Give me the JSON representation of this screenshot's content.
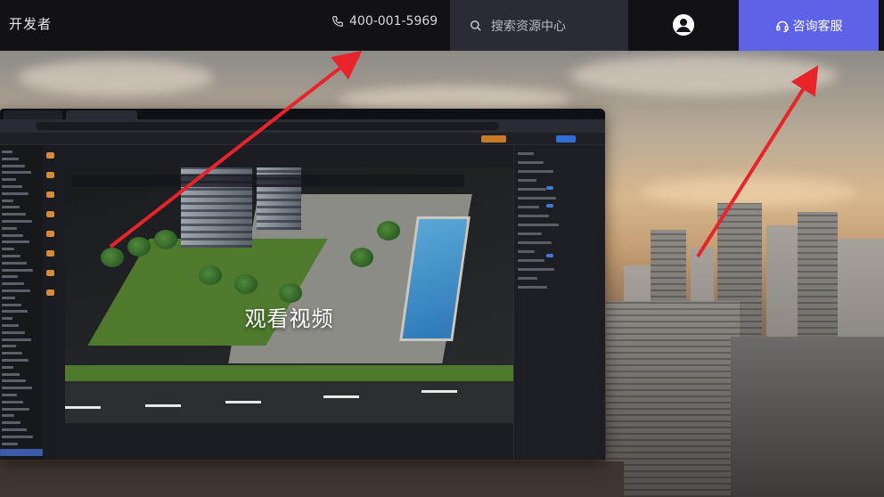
{
  "header": {
    "brand": "开发者",
    "phone": "400-001-5969",
    "search_placeholder": "搜索资源中心",
    "consult_label": "咨询客服"
  },
  "hero": {
    "play_label": "观看视频"
  },
  "colors": {
    "topbar_bg": "#121116",
    "search_bg": "#2b2b33",
    "consult_bg": "#5d63e8",
    "arrow": "#e8232a"
  },
  "icons": {
    "phone": "phone-icon",
    "search": "search-icon",
    "avatar": "user-avatar-icon",
    "headset": "headset-icon"
  }
}
